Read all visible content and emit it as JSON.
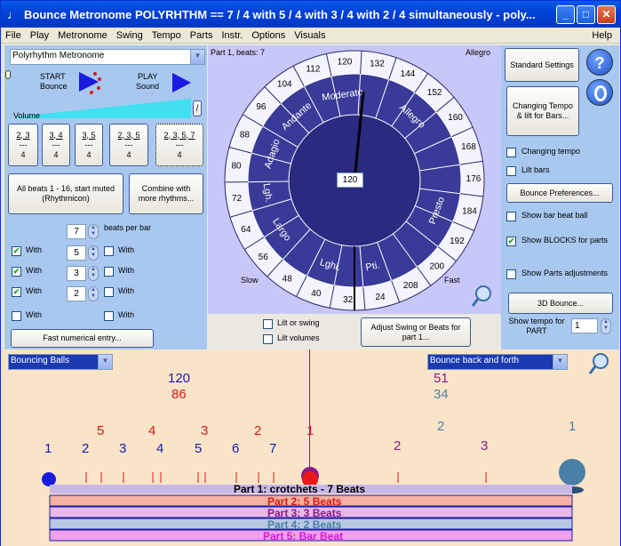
{
  "window": {
    "title": "Bounce Metronome POLYRHTHM == 7 / 4 with 5 / 4 with 3 / 4 with 2 / 4 simultaneously - poly...",
    "controls": [
      "_",
      "□",
      "✕"
    ]
  },
  "menu": [
    "File",
    "Play",
    "Metronome",
    "Swing",
    "Tempo",
    "Parts",
    "Instr.",
    "Options",
    "Visuals"
  ],
  "menu_help": "Help",
  "left": {
    "mode_select": "Polyrhythm Metronome",
    "start_label_1": "START",
    "start_label_2": "Bounce",
    "play_label_1": "PLAY",
    "play_label_2": "Sound",
    "volume_label": "Volume",
    "volume_slider_glyph": "/",
    "ratio_buttons": [
      {
        "top": "2, 3",
        "line": "---",
        "bottom": "4"
      },
      {
        "top": "3, 4",
        "line": "---",
        "bottom": "4"
      },
      {
        "top": "3, 5",
        "line": "---",
        "bottom": "4"
      },
      {
        "top": "2, 3, 5",
        "line": "---",
        "bottom": "4"
      },
      {
        "top": "2, 3, 5, 7",
        "line": "---",
        "bottom": "4"
      }
    ],
    "all_beats_button": "All beats 1 - 16, start muted (Rhythmicon)",
    "combine_button": "Combine with more rhythms...",
    "beats_per_bar_value": "7",
    "beats_per_bar_label": "beats per bar",
    "rows": [
      {
        "with": "With",
        "value": "5",
        "with2": "With"
      },
      {
        "with": "With",
        "value": "3",
        "with2": "With"
      },
      {
        "with": "With",
        "value": "2",
        "with2": "With"
      },
      {
        "with": "With",
        "value": "",
        "with2": "With"
      }
    ],
    "fast_entry_button": "Fast numerical entry..."
  },
  "dial": {
    "part_label": "Part 1, beats: 7",
    "corner_label": "Allegro",
    "slow_label": "Slow",
    "fast_label": "Fast",
    "tempo_value": "120",
    "outer_ticks": [
      "104",
      "112",
      "120",
      "132",
      "144",
      "152",
      "160",
      "168",
      "176",
      "184",
      "192",
      "200",
      "208",
      "24",
      "32",
      "40",
      "48",
      "56",
      "64",
      "72",
      "80",
      "88",
      "96"
    ],
    "sections": [
      "Moderato",
      "Allegro",
      "Presto",
      "Pti.",
      "Lghi.",
      "Largo",
      "Lgh.",
      "Adagio",
      "Andante"
    ]
  },
  "right": {
    "standard_button": "Standard Settings",
    "help_icon": "?",
    "changing_tempo_button": "Changing Tempo & lilt for Bars...",
    "changing_tempo_check": "Changing tempo",
    "lilt_bars_check": "Lilt bars",
    "bounce_prefs_button": "Bounce Preferences...",
    "show_bar_ball": "Show bar beat ball",
    "show_blocks": "Show BLOCKS for parts",
    "show_parts_adj": "Show Parts adjustments",
    "bounce3d_button": "3D Bounce...",
    "show_tempo_label": "Show tempo for PART",
    "show_tempo_value": "1"
  },
  "lower": {
    "lilt_swing": "Lilt or swing",
    "lilt_volumes": "Lilt volumes",
    "adjust_button": "Adjust Swing or Beats for part 1..."
  },
  "bottom": {
    "balls_select": "Bouncing Balls",
    "bounce_select": "Bounce back and forth",
    "tempo_left_top": "120",
    "tempo_left_bottom": "86",
    "tempo_right_top": "51",
    "tempo_right_bottom": "34",
    "row5": [
      "5",
      "4",
      "3",
      "2",
      "1"
    ],
    "row7": [
      "1",
      "2",
      "3",
      "4",
      "5",
      "6",
      "7"
    ],
    "row3": [
      "2",
      "3"
    ],
    "row2": [
      "2",
      "1"
    ],
    "parts": [
      {
        "label": "Part 1: crotchets - 7 Beats",
        "color": "#1a1aa8"
      },
      {
        "label": "Part 2: 5 Beats",
        "color": "#d81818"
      },
      {
        "label": "Part 3: 3 Beats",
        "color": "#8a1a8a"
      },
      {
        "label": "Part 4: 2 Beats",
        "color": "#4a7fa8"
      },
      {
        "label": "Part 5: Bar Beat",
        "color": "#d818d8"
      }
    ]
  }
}
